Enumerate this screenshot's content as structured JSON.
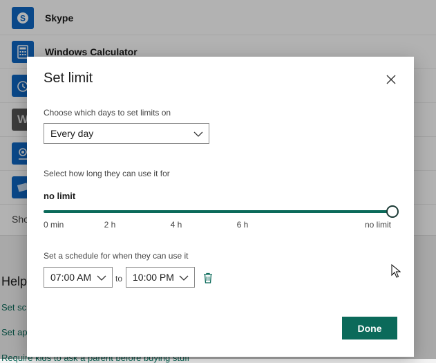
{
  "background": {
    "apps": [
      {
        "name": "Skype",
        "icon": "skype-icon",
        "color": "#0f68c5"
      },
      {
        "name": "Windows Calculator",
        "icon": "calculator-icon",
        "color": "#0f68c5"
      },
      {
        "name": "",
        "icon": "alarm-icon",
        "color": "#0f68c5"
      },
      {
        "name": "",
        "icon": "word-icon",
        "color": "#555555"
      },
      {
        "name": "",
        "icon": "maps-icon",
        "color": "#0f68c5"
      },
      {
        "name": "",
        "icon": "photos-icon",
        "color": "#0f68c5"
      }
    ],
    "show_link": "Sho",
    "help_title": "Help",
    "help_links": [
      "Set scr",
      "Set ap",
      "Require kids to ask a parent before buying stuff"
    ]
  },
  "dialog": {
    "title": "Set limit",
    "days_label": "Choose which days to set limits on",
    "days_value": "Every day",
    "duration_label": "Select how long they can use it for",
    "duration_value": "no limit",
    "slider": {
      "ticks": [
        "0 min",
        "2 h",
        "4 h",
        "6 h",
        "no limit"
      ],
      "value_fraction": 1.0
    },
    "schedule_label": "Set a schedule for when they can use it",
    "from_time": "07:00 AM",
    "to_label": "to",
    "to_time": "10:00 PM",
    "done_label": "Done"
  },
  "colors": {
    "accent": "#0b6a5a"
  }
}
